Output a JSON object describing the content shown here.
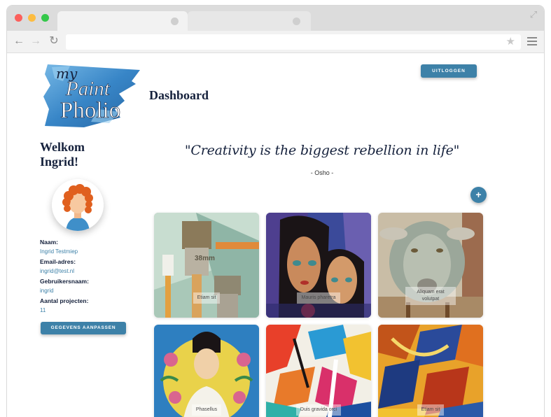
{
  "browser": {
    "back_icon": "arrow-left-icon",
    "forward_icon": "arrow-right-icon",
    "reload_icon": "reload-icon",
    "bookmark_icon": "star-icon",
    "menu_icon": "hamburger-menu-icon",
    "expand_icon": "expand-icon"
  },
  "header": {
    "logo_text_top": "my",
    "logo_text_mid": "Paint",
    "logo_text_bottom": "Pholio",
    "title": "Dashboard",
    "logout_label": "UITLOGGEN"
  },
  "profile": {
    "welcome_line1": "Welkom",
    "welcome_line2": "Ingrid!",
    "fields": [
      {
        "label": "Naam:",
        "value": "Ingrid Testmiep"
      },
      {
        "label": "Email-adres:",
        "value": "ingrid@test.nl"
      },
      {
        "label": "Gebruikersnaam:",
        "value": "ingrid"
      },
      {
        "label": "Aantal projecten:",
        "value": "11"
      }
    ],
    "edit_label": "GEGEVENS AANPASSEN"
  },
  "quote": {
    "text": "\"Creativity is the biggest rebellion in life\"",
    "author": "- Osho -"
  },
  "add_button": "+",
  "projects": [
    {
      "title": "Etiam sit"
    },
    {
      "title": "Mauris pharetra"
    },
    {
      "title": "Aliquam erat volutpat"
    },
    {
      "title": "Phasellus"
    },
    {
      "title": "Duis gravida orci"
    },
    {
      "title": "Etiam sit"
    }
  ],
  "colors": {
    "accent": "#3d81a8",
    "heading": "#15213c"
  }
}
